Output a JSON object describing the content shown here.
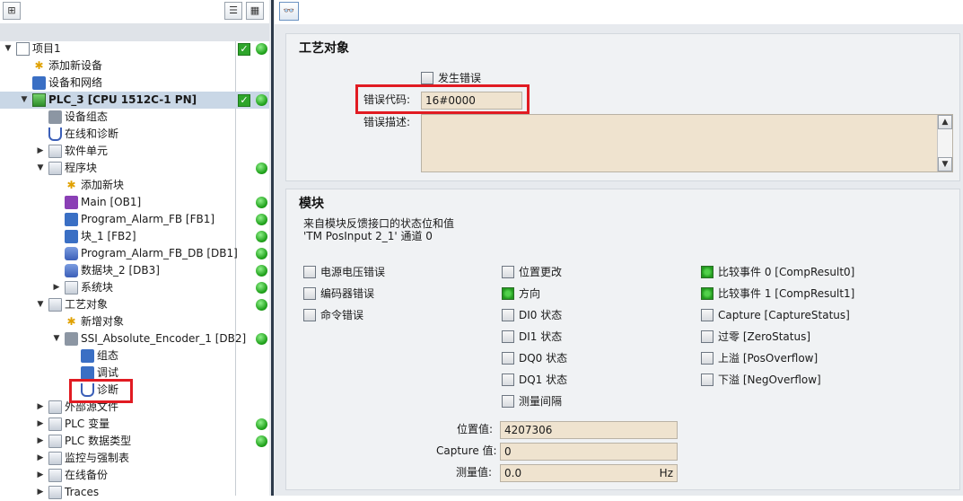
{
  "left_tree": {
    "items": [
      {
        "label": "项目1",
        "indent": 0,
        "arrow": "▼",
        "icon": "project-icon",
        "check": true,
        "dot": true
      },
      {
        "label": "添加新设备",
        "indent": 1,
        "arrow": "",
        "icon": "add-device-icon",
        "check": false,
        "dot": false
      },
      {
        "label": "设备和网络",
        "indent": 1,
        "arrow": "",
        "icon": "network-icon",
        "check": false,
        "dot": false
      },
      {
        "label": "PLC_3 [CPU 1512C-1 PN]",
        "indent": 1,
        "arrow": "▼",
        "icon": "cpu-icon",
        "check": true,
        "dot": true,
        "selected": true
      },
      {
        "label": "设备组态",
        "indent": 2,
        "arrow": "",
        "icon": "device-config-icon",
        "check": false,
        "dot": false
      },
      {
        "label": "在线和诊断",
        "indent": 2,
        "arrow": "",
        "icon": "online-diagnostics-icon",
        "check": false,
        "dot": false
      },
      {
        "label": "软件单元",
        "indent": 2,
        "arrow": "▶",
        "icon": "software-units-icon",
        "check": false,
        "dot": false
      },
      {
        "label": "程序块",
        "indent": 2,
        "arrow": "▼",
        "icon": "folder-icon",
        "check": false,
        "dot": true
      },
      {
        "label": "添加新块",
        "indent": 3,
        "arrow": "",
        "icon": "add-block-icon",
        "check": false,
        "dot": false
      },
      {
        "label": "Main [OB1]",
        "indent": 3,
        "arrow": "",
        "icon": "ob-block-icon",
        "check": false,
        "dot": true
      },
      {
        "label": "Program_Alarm_FB [FB1]",
        "indent": 3,
        "arrow": "",
        "icon": "fb-block-icon",
        "check": false,
        "dot": true
      },
      {
        "label": "块_1 [FB2]",
        "indent": 3,
        "arrow": "",
        "icon": "fb-block-icon",
        "check": false,
        "dot": true
      },
      {
        "label": "Program_Alarm_FB_DB [DB1]",
        "indent": 3,
        "arrow": "",
        "icon": "db-block-icon",
        "check": false,
        "dot": true
      },
      {
        "label": "数据块_2 [DB3]",
        "indent": 3,
        "arrow": "",
        "icon": "db-block-icon",
        "check": false,
        "dot": true
      },
      {
        "label": "系统块",
        "indent": 3,
        "arrow": "▶",
        "icon": "system-blocks-icon",
        "check": false,
        "dot": true
      },
      {
        "label": "工艺对象",
        "indent": 2,
        "arrow": "▼",
        "icon": "technology-objects-icon",
        "check": false,
        "dot": true
      },
      {
        "label": "新增对象",
        "indent": 3,
        "arrow": "",
        "icon": "add-object-icon",
        "check": false,
        "dot": false
      },
      {
        "label": "SSI_Absolute_Encoder_1 [DB2]",
        "indent": 3,
        "arrow": "▼",
        "icon": "encoder-object-icon",
        "check": false,
        "dot": true
      },
      {
        "label": "组态",
        "indent": 4,
        "arrow": "",
        "icon": "configuration-icon",
        "check": false,
        "dot": false
      },
      {
        "label": "调试",
        "indent": 4,
        "arrow": "",
        "icon": "commissioning-icon",
        "check": false,
        "dot": false
      },
      {
        "label": "诊断",
        "indent": 4,
        "arrow": "",
        "icon": "diagnostics-icon",
        "check": false,
        "dot": false,
        "highlight": true
      },
      {
        "label": "外部源文件",
        "indent": 2,
        "arrow": "▶",
        "icon": "folder-icon",
        "check": false,
        "dot": false
      },
      {
        "label": "PLC 变量",
        "indent": 2,
        "arrow": "▶",
        "icon": "plc-tags-icon",
        "check": false,
        "dot": true
      },
      {
        "label": "PLC 数据类型",
        "indent": 2,
        "arrow": "▶",
        "icon": "plc-data-types-icon",
        "check": false,
        "dot": true
      },
      {
        "label": "监控与强制表",
        "indent": 2,
        "arrow": "▶",
        "icon": "watch-tables-icon",
        "check": false,
        "dot": false
      },
      {
        "label": "在线备份",
        "indent": 2,
        "arrow": "▶",
        "icon": "online-backup-icon",
        "check": false,
        "dot": false
      },
      {
        "label": "Traces",
        "indent": 2,
        "arrow": "▶",
        "icon": "traces-icon",
        "check": false,
        "dot": false
      }
    ]
  },
  "tech_object_section": {
    "title": "工艺对象",
    "error_checkbox_label": "发生错误",
    "error_code_label": "错误代码:",
    "error_code_value": "16#0000",
    "error_desc_label": "错误描述:",
    "error_desc_value": ""
  },
  "module_section": {
    "title": "模块",
    "desc_line1": "来自模块反馈接口的状态位和值",
    "desc_line2": "'TM PosInput 2_1' 通道 0",
    "col1": [
      {
        "label": "电源电压错误",
        "on": false
      },
      {
        "label": "编码器错误",
        "on": false
      },
      {
        "label": "命令错误",
        "on": false
      }
    ],
    "col2": [
      {
        "label": "位置更改",
        "on": false
      },
      {
        "label": "方向",
        "on": true
      },
      {
        "label": "DI0 状态",
        "on": false
      },
      {
        "label": "DI1 状态",
        "on": false
      },
      {
        "label": "DQ0 状态",
        "on": false
      },
      {
        "label": "DQ1 状态",
        "on": false
      },
      {
        "label": "测量间隔",
        "on": false
      }
    ],
    "col3": [
      {
        "label": "比较事件 0 [CompResult0]",
        "on": true
      },
      {
        "label": "比较事件 1 [CompResult1]",
        "on": true
      },
      {
        "label": "Capture [CaptureStatus]",
        "on": false
      },
      {
        "label": "过零 [ZeroStatus]",
        "on": false
      },
      {
        "label": "上溢 [PosOverflow]",
        "on": false
      },
      {
        "label": "下溢 [NegOverflow]",
        "on": false
      }
    ],
    "position_label": "位置值:",
    "position_value": "4207306",
    "capture_label": "Capture 值:",
    "capture_value": "0",
    "measure_label": "测量值:",
    "measure_value": "0.0",
    "measure_unit": "Hz"
  }
}
